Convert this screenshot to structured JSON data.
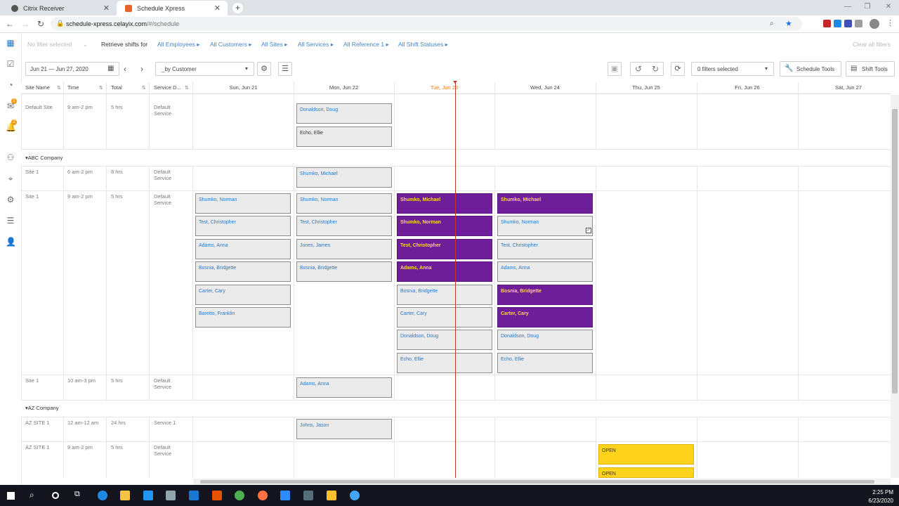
{
  "browser": {
    "tabs": [
      {
        "title": "Citrix Receiver",
        "active": false
      },
      {
        "title": "Schedule Xpress",
        "active": true
      }
    ],
    "url_host": "schedule-xpress.celayix.com",
    "url_path": "/#/schedule"
  },
  "filters": {
    "no_filter": "No filter selected",
    "retrieve_label": "Retrieve shifts for",
    "items": [
      "All Employees",
      "All Customers",
      "All Sites",
      "All Services",
      "All Reference 1",
      "All Shift Statuses"
    ],
    "clear_all": "Clear all filters"
  },
  "controls": {
    "date_range": "Jun 21 — Jun 27, 2020",
    "group_by": "_by Customer",
    "filters_selected": "0 filters selected",
    "schedule_tools": "Schedule Tools",
    "shift_tools": "Shift Tools"
  },
  "columns": {
    "left": [
      "Site Name",
      "Time",
      "Total",
      "Service D..."
    ],
    "days": [
      "Sun, Jun 21",
      "Mon, Jun 22",
      "Tue, Jun 23",
      "Wed, Jun 24",
      "Thu, Jun 25",
      "Fri, Jun 26",
      "Sat, Jun 27"
    ],
    "today_index": 2
  },
  "groups": [
    "ABC Company",
    "AZ Company"
  ],
  "rows": [
    {
      "site": "Default Site",
      "time": "9 am-2 pm",
      "total": "5 hrs",
      "service": "Default Service"
    },
    {
      "site": "Site 1",
      "time": "6 am-2 pm",
      "total": "8 hrs",
      "service": "Default Service"
    },
    {
      "site": "Site 1",
      "time": "9 am-2 pm",
      "total": "5 hrs",
      "service": "Default Service"
    },
    {
      "site": "Site 1",
      "time": "10 am-3 pm",
      "total": "5 hrs",
      "service": "Default Service"
    },
    {
      "site": "AZ SITE 1",
      "time": "12 am-12 am",
      "total": "24 hrs",
      "service": "Service 1"
    },
    {
      "site": "AZ SITE 1",
      "time": "9 am-2 pm",
      "total": "5 hrs",
      "service": "Default Service"
    }
  ],
  "shifts": [
    {
      "name": "Donaldson, Doug",
      "style": "grey"
    },
    {
      "name": "Echo, Ellie",
      "style": "grey-dark"
    },
    {
      "name": "Shumko, Michael",
      "style": "grey"
    },
    {
      "name": "Shumko, Norman",
      "style": "grey"
    },
    {
      "name": "Test, Christopher",
      "style": "grey"
    },
    {
      "name": "Adams, Anna",
      "style": "grey"
    },
    {
      "name": "Bosnia, Bridgette",
      "style": "grey"
    },
    {
      "name": "Carter, Cary",
      "style": "grey"
    },
    {
      "name": "Baretto, Franklin",
      "style": "grey"
    },
    {
      "name": "Shumko, Norman",
      "style": "grey"
    },
    {
      "name": "Test, Christopher",
      "style": "grey"
    },
    {
      "name": "Jones, James",
      "style": "grey"
    },
    {
      "name": "Bosnia, Bridgette",
      "style": "grey"
    },
    {
      "name": "Shumko, Michael",
      "style": "purple"
    },
    {
      "name": "Shumko, Norman",
      "style": "purple"
    },
    {
      "name": "Test, Christopher",
      "style": "purple"
    },
    {
      "name": "Adams, Anna",
      "style": "purple"
    },
    {
      "name": "Bosnia, Bridgette",
      "style": "grey"
    },
    {
      "name": "Carter, Cary",
      "style": "grey"
    },
    {
      "name": "Donaldson, Doug",
      "style": "grey"
    },
    {
      "name": "Echo, Ellie",
      "style": "grey"
    },
    {
      "name": "Shumko, Michael",
      "style": "purple"
    },
    {
      "name": "Shumko, Norman",
      "style": "grey"
    },
    {
      "name": "Test, Christopher",
      "style": "grey"
    },
    {
      "name": "Adams, Anna",
      "style": "grey"
    },
    {
      "name": "Bosnia, Bridgette",
      "style": "purple"
    },
    {
      "name": "Carter, Cary",
      "style": "purple"
    },
    {
      "name": "Donaldson, Doug",
      "style": "grey"
    },
    {
      "name": "Echo, Ellie",
      "style": "grey"
    },
    {
      "name": "Adams, Anna",
      "style": "grey"
    },
    {
      "name": "Johns, Jason",
      "style": "grey"
    },
    {
      "name": "OPEN",
      "style": "yellow"
    },
    {
      "name": "OPEN",
      "style": "yellow"
    }
  ],
  "taskbar": {
    "time": "2:25 PM",
    "date": "6/23/2020"
  },
  "colors": {
    "accent_blue": "#2a78c2",
    "purple": "#6f1e99",
    "open_yellow": "#ffd21c",
    "today_line": "#c0392b"
  }
}
